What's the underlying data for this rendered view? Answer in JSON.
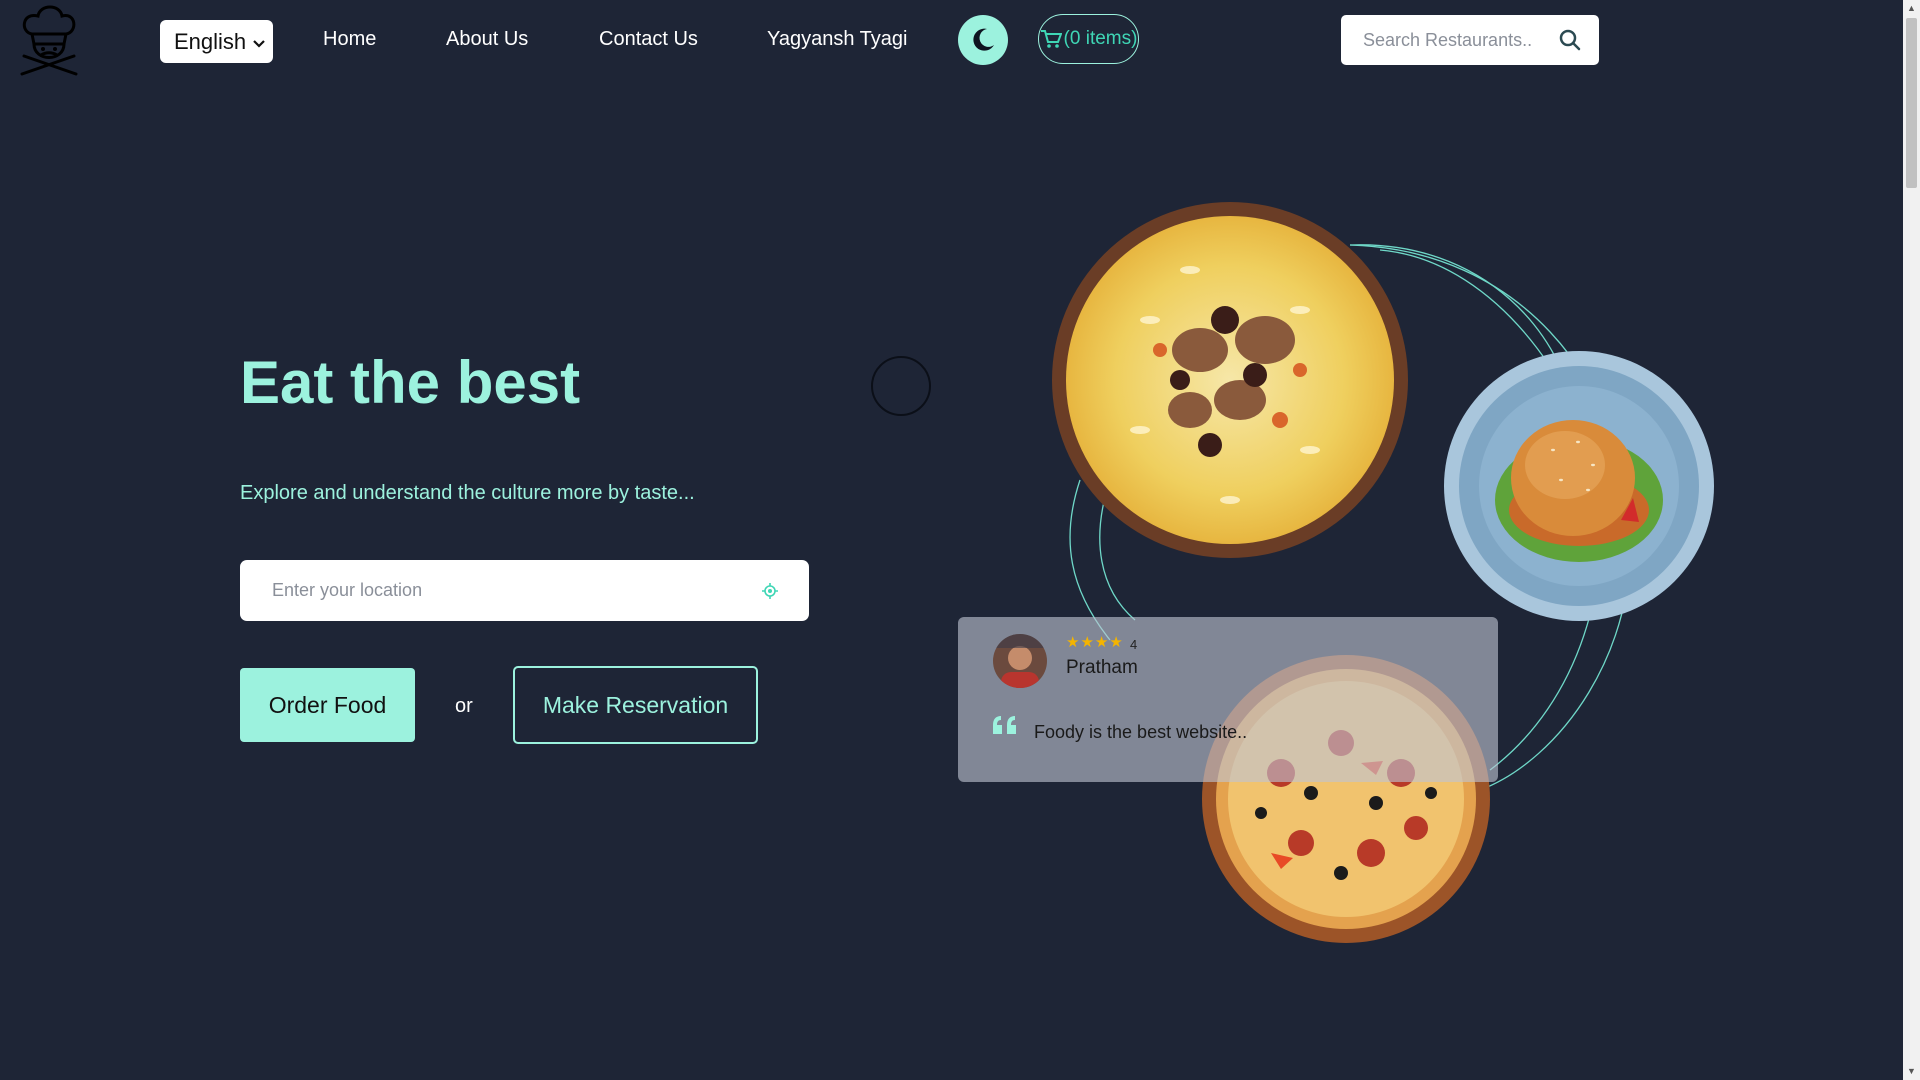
{
  "nav": {
    "language": "English",
    "links": {
      "home": "Home",
      "about": "About Us",
      "contact": "Contact Us",
      "user": "Yagyansh Tyagi"
    },
    "cart_label": "(0 items)",
    "search_placeholder": "Search Restaurants.."
  },
  "hero": {
    "title": "Eat the best",
    "subtitle": "Explore and understand the culture more by taste...",
    "location_placeholder": "Enter your location",
    "order_button": "Order Food",
    "or_text": "or",
    "reservation_button": "Make Reservation"
  },
  "review": {
    "rating": "4",
    "rating_value": 4,
    "rating_max": 4,
    "name": "Pratham",
    "text": "Foody is the best website.."
  },
  "theme": {
    "accent": "#9cf2de",
    "accent_dark": "#3fd6b5",
    "background": "#1e2536"
  },
  "icons": {
    "logo": "chef-logo-icon",
    "theme_toggle": "moon-icon",
    "cart": "cart-icon",
    "search": "search-icon",
    "location": "location-target-icon",
    "quote": "quote-icon",
    "star": "star-icon"
  }
}
